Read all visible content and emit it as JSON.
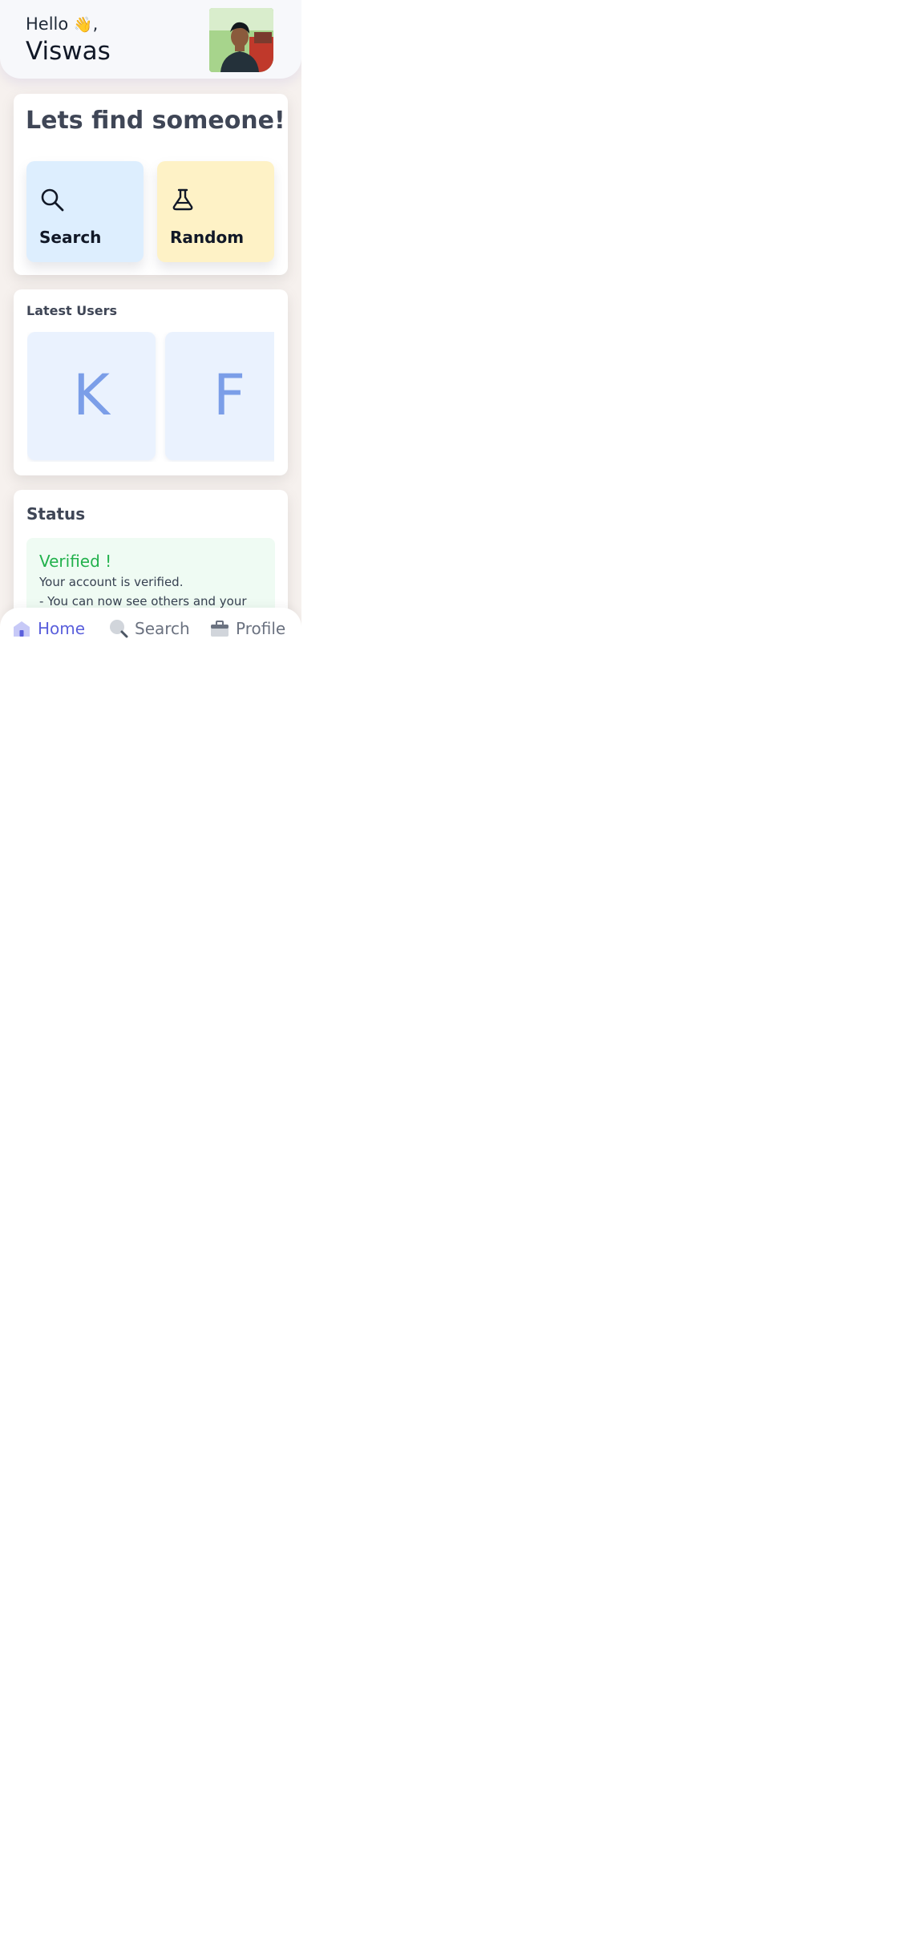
{
  "header": {
    "greeting": "Hello",
    "wave_emoji": "👋",
    "greeting_suffix": ",",
    "user_name": "Viswas",
    "avatar_icon": "user-photo"
  },
  "find": {
    "title": "Lets find someone!",
    "tiles": [
      {
        "label": "Search",
        "icon": "search-icon",
        "bg": "#ddeefe"
      },
      {
        "label": "Random",
        "icon": "flask-icon",
        "bg": "#fef2c6"
      }
    ]
  },
  "latest": {
    "title": "Latest Users",
    "users": [
      {
        "initial": "K"
      },
      {
        "initial": "F"
      }
    ]
  },
  "status": {
    "title": "Status",
    "heading": "Verified !",
    "lines": [
      "Your account is verified.",
      "- You can now see others and your"
    ],
    "accent": "#22b14c"
  },
  "nav": {
    "items": [
      {
        "label": "Home",
        "icon": "home-icon",
        "active": true
      },
      {
        "label": "Search",
        "icon": "search-icon",
        "active": false
      },
      {
        "label": "Profile",
        "icon": "briefcase-icon",
        "active": false
      }
    ],
    "active_color": "#5a5fdc",
    "inactive_color": "#6b7280"
  }
}
